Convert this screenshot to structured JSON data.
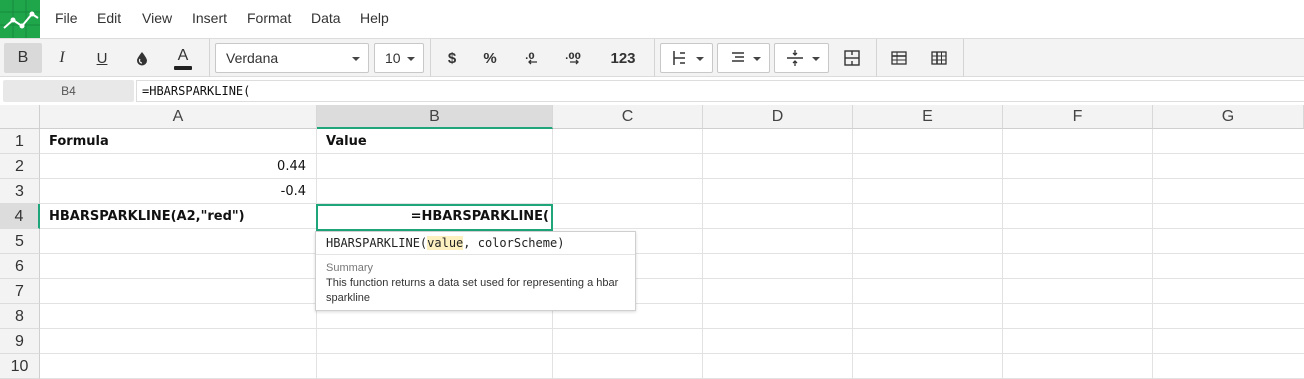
{
  "menu": {
    "items": [
      "File",
      "Edit",
      "View",
      "Insert",
      "Format",
      "Data",
      "Help"
    ]
  },
  "toolbar": {
    "bold": "B",
    "italic": "I",
    "underline": "U",
    "text_color": "A",
    "font_family": "Verdana",
    "font_size": "10",
    "currency": "$",
    "percent": "%",
    "decrease_decimals": ".0",
    "increase_decimals": ".00",
    "number_format": "123"
  },
  "formula_bar": {
    "cell_ref": "B4",
    "value": "=HBARSPARKLINE("
  },
  "columns": [
    "A",
    "B",
    "C",
    "D",
    "E",
    "F",
    "G"
  ],
  "rows": [
    "1",
    "2",
    "3",
    "4",
    "5",
    "6",
    "7",
    "8",
    "9",
    "10"
  ],
  "cells": {
    "A1": "Formula",
    "B1": "Value",
    "A2": "0.44",
    "A3": "-0.4",
    "A4": "HBARSPARKLINE(A2,\"red\")",
    "B4": "=HBARSPARKLINE("
  },
  "autocomplete": {
    "func_name": "HBARSPARKLINE(",
    "arg_active": "value",
    "arg_rest": ", colorScheme)",
    "summary_label": "Summary",
    "description": "This function returns a data set used for representing a hbar sparkline"
  },
  "colors": {
    "accent": "#1fa57a",
    "logo": "#1fa54a"
  }
}
